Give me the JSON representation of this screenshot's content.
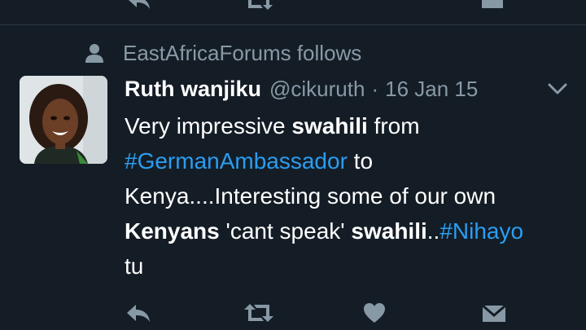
{
  "context": {
    "icon": "person-icon",
    "text": "EastAfricaForums follows"
  },
  "tweet": {
    "author_name": "Ruth wanjiku",
    "handle": "@cikuruth",
    "separator": "·",
    "date": "16 Jan 15",
    "lines": {
      "l1_a": "Very impressive ",
      "l1_b": "swahili",
      "l1_c": " from",
      "l2_a": "#GermanAmbassador",
      "l2_b": " to",
      "l3_a": "Kenya....Interesting some of our own",
      "l4_a": "Kenyans",
      "l4_b": " 'cant speak' ",
      "l4_c": "swahili",
      "l4_d": "..",
      "l4_e": "#Nihayo",
      "l5_a": "tu"
    }
  },
  "colors": {
    "background": "#141d26",
    "secondary_text": "#8899a6",
    "hashtag": "#2b9df0",
    "icon": "#8899a6"
  },
  "actions": [
    "reply-icon",
    "retweet-icon",
    "like-icon",
    "message-icon"
  ]
}
